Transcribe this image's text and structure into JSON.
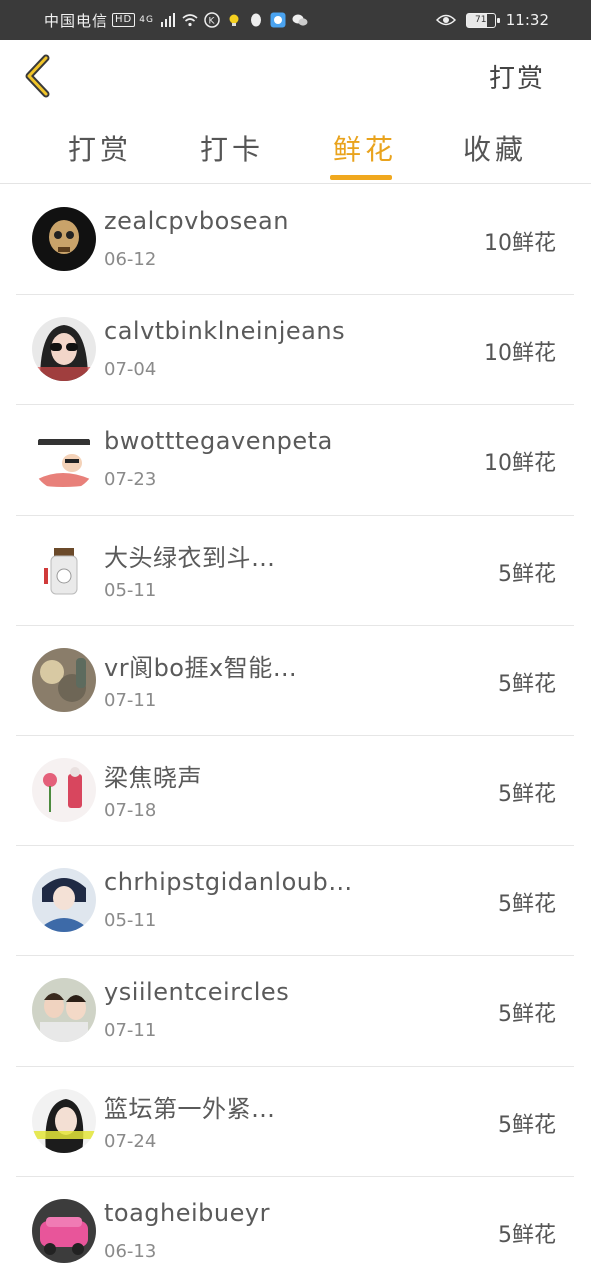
{
  "status_bar": {
    "carrier": "中国电信",
    "hd": "HD",
    "network": "4G",
    "battery": "71",
    "time": "11:32"
  },
  "header": {
    "back_icon": "chevron-left-icon",
    "action_label": "打赏"
  },
  "tabs": [
    {
      "label": "打赏",
      "active": false
    },
    {
      "label": "打卡",
      "active": false
    },
    {
      "label": "鲜花",
      "active": true
    },
    {
      "label": "收藏",
      "active": false
    }
  ],
  "colors": {
    "accent": "#f0a81e",
    "status_bar_bg": "#3a3a3a",
    "divider": "#e6e6e6"
  },
  "list": [
    {
      "name": "zealcpvbosean",
      "date": "06-12",
      "amount": "10鲜花"
    },
    {
      "name": "calvtbinklneinjeans",
      "date": "07-04",
      "amount": "10鲜花"
    },
    {
      "name": "bwotttegavenpeta",
      "date": "07-23",
      "amount": "10鲜花"
    },
    {
      "name": "大头绿衣到斗…",
      "date": "05-11",
      "amount": "5鲜花"
    },
    {
      "name": "vr阆bo捱x智能…",
      "date": "07-11",
      "amount": "5鲜花"
    },
    {
      "name": "梁焦晓声",
      "date": "07-18",
      "amount": "5鲜花"
    },
    {
      "name": "chrhipstgidanloub…",
      "date": "05-11",
      "amount": "5鲜花"
    },
    {
      "name": "ysiilentceircles",
      "date": "07-11",
      "amount": "5鲜花"
    },
    {
      "name": "篮坛第一外紧…",
      "date": "07-24",
      "amount": "5鲜花"
    },
    {
      "name": "toagheibueyr",
      "date": "06-13",
      "amount": "5鲜花"
    }
  ]
}
